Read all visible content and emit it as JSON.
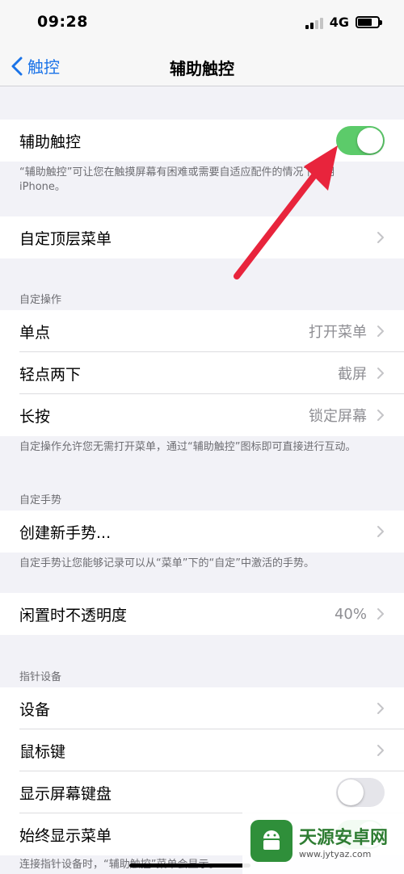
{
  "status_bar": {
    "time": "09:28",
    "network": "4G"
  },
  "nav": {
    "back_label": "触控",
    "title": "辅助触控"
  },
  "assistive_touch": {
    "label": "辅助触控",
    "enabled": true,
    "description": "“辅助触控”可让您在触摸屏幕有困难或需要自适应配件的情况下使用 iPhone。"
  },
  "top_menu": {
    "label": "自定顶层菜单"
  },
  "custom_actions": {
    "header": "自定操作",
    "items": [
      {
        "label": "单点",
        "value": "打开菜单"
      },
      {
        "label": "轻点两下",
        "value": "截屏"
      },
      {
        "label": "长按",
        "value": "锁定屏幕"
      }
    ],
    "footer": "自定操作允许您无需打开菜单，通过“辅助触控”图标即可直接进行互动。"
  },
  "custom_gestures": {
    "header": "自定手势",
    "create_label": "创建新手势...",
    "footer": "自定手势让您能够记录可以从“菜单”下的“自定”中激活的手势。"
  },
  "idle_opacity": {
    "label": "闲置时不透明度",
    "value": "40%"
  },
  "pointer_devices": {
    "header": "指针设备",
    "devices_label": "设备",
    "mouse_keys_label": "鼠标键",
    "show_keyboard_label": "显示屏幕键盘",
    "show_keyboard_enabled": false,
    "always_show_menu_label": "始终显示菜单",
    "always_show_menu_enabled": true,
    "footer": "连接指针设备时，“辅助触控”菜单会显示。"
  },
  "watermark": {
    "title": "天源安卓网",
    "url": "www.jytyaz.com"
  },
  "colors": {
    "accent": "#1a73e8",
    "toggle_on": "#5ccb6a",
    "arrow": "#e8243c"
  }
}
